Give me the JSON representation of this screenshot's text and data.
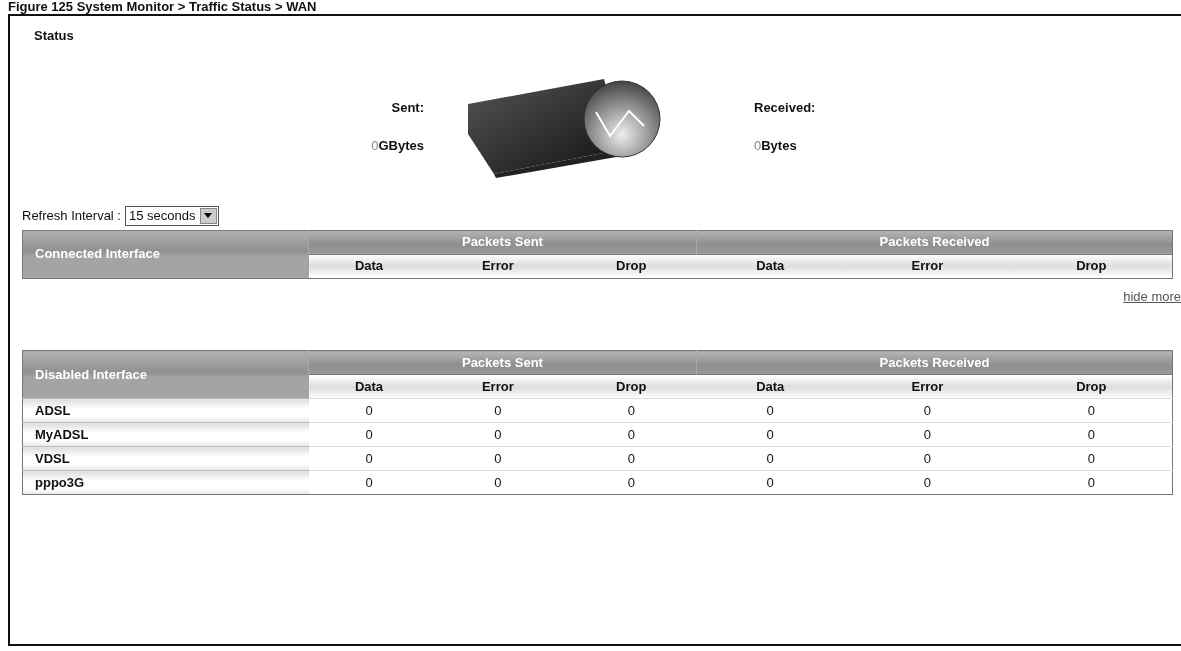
{
  "caption": "Figure 125 System Monitor > Traffic Status > WAN",
  "title": "Status",
  "sent": {
    "label": "Sent:",
    "value": "0",
    "unit": "GBytes"
  },
  "received": {
    "label": "Received:",
    "value": "0",
    "unit": "Bytes"
  },
  "refresh": {
    "label": "Refresh Interval :",
    "value": "15 seconds"
  },
  "connected_table": {
    "first_header": "Connected Interface",
    "groups": [
      "Packets Sent",
      "Packets Received"
    ],
    "columns": [
      "Data",
      "Error",
      "Drop",
      "Data",
      "Error",
      "Drop"
    ]
  },
  "hide_more_link": "hide more",
  "disabled_table": {
    "first_header": "Disabled Interface",
    "groups": [
      "Packets Sent",
      "Packets Received"
    ],
    "columns": [
      "Data",
      "Error",
      "Drop",
      "Data",
      "Error",
      "Drop"
    ],
    "rows": [
      {
        "name": "ADSL",
        "values": [
          "0",
          "0",
          "0",
          "0",
          "0",
          "0"
        ]
      },
      {
        "name": "MyADSL",
        "values": [
          "0",
          "0",
          "0",
          "0",
          "0",
          "0"
        ]
      },
      {
        "name": "VDSL",
        "values": [
          "0",
          "0",
          "0",
          "0",
          "0",
          "0"
        ]
      },
      {
        "name": "pppo3G",
        "values": [
          "0",
          "0",
          "0",
          "0",
          "0",
          "0"
        ]
      }
    ]
  }
}
